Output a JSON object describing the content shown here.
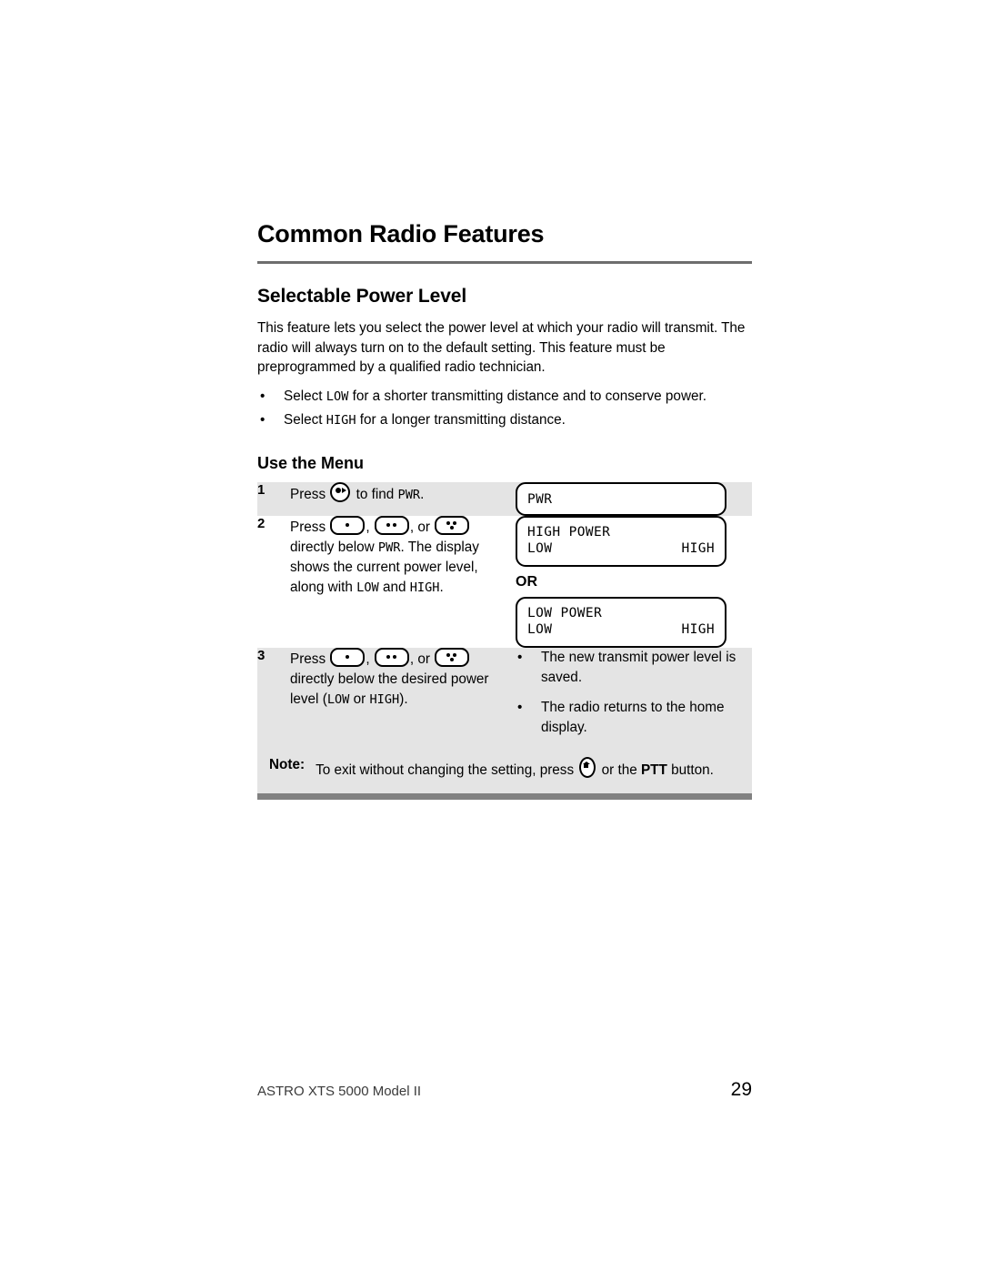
{
  "chapter": {
    "title": "Common Radio Features"
  },
  "section": {
    "title": "Selectable Power Level",
    "intro": "This feature lets you select the power level at which your radio will transmit. The radio will always turn on to the default setting. This feature must be preprogrammed by a qualified radio technician.",
    "bullets": [
      {
        "pre": "Select ",
        "code": "LOW",
        "post": " for a shorter transmitting distance and to conserve power."
      },
      {
        "pre": "Select ",
        "code": "HIGH",
        "post": " for a longer transmitting distance."
      }
    ]
  },
  "procedure": {
    "title": "Use the Menu",
    "steps": [
      {
        "number": "1",
        "text_pre": "Press ",
        "icon": "menu-select-icon",
        "text_mid": " to find ",
        "code": "PWR",
        "text_post": ".",
        "display": {
          "line1": "PWR"
        }
      },
      {
        "number": "2",
        "text_pre": "Press ",
        "text_mid": ", or ",
        "text_after_icons": " directly below ",
        "code1": "PWR",
        "text_tail1": ". The display shows the current power level, along with ",
        "code2": "LOW",
        "text_tail2": " and ",
        "code3": "HIGH",
        "text_tail3": ".",
        "displays": [
          {
            "line1": "HIGH POWER",
            "left": "LOW",
            "right": "HIGH"
          },
          {
            "line1": "LOW POWER",
            "left": "LOW",
            "right": "HIGH"
          }
        ],
        "or_label": "OR"
      },
      {
        "number": "3",
        "text_pre": "Press ",
        "text_mid": ", or ",
        "text_after_icons": " directly below the desired power level (",
        "code1": "LOW",
        "text_tail1": " or ",
        "code2": "HIGH",
        "text_tail2": ").",
        "results": [
          "The new transmit power level is saved.",
          "The radio returns to the home display."
        ]
      }
    ],
    "note": {
      "label": "Note:",
      "text_pre": "To exit without changing the setting, press ",
      "icon": "home-button-icon",
      "text_mid": " or the ",
      "bold": "PTT",
      "text_post": " button."
    }
  },
  "footer": {
    "product": "ASTRO XTS 5000 Model II",
    "page_number": "29"
  },
  "colors": {
    "row_shade": "#e4e4e4",
    "rule": "#6e6e6e",
    "footer_bar": "#818181"
  }
}
